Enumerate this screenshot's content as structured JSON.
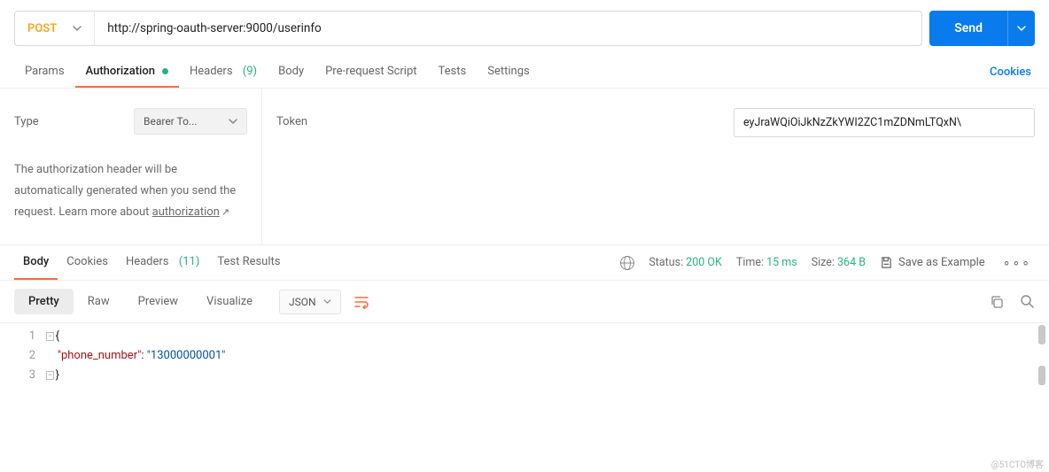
{
  "request": {
    "method": "POST",
    "url": "http://spring-oauth-server:9000/userinfo",
    "send_label": "Send"
  },
  "req_tabs": {
    "params": "Params",
    "authorization": "Authorization",
    "headers": "Headers",
    "headers_count": "(9)",
    "body": "Body",
    "prereq": "Pre-request Script",
    "tests": "Tests",
    "settings": "Settings",
    "cookies": "Cookies"
  },
  "auth": {
    "type_label": "Type",
    "type_value": "Bearer To...",
    "desc_line": "The authorization header will be automatically generated when you send the request. Learn more about ",
    "desc_link": "authorization",
    "token_label": "Token",
    "token_value": "eyJraWQiOiJkNzZkYWI2ZC1mZDNmLTQxN\\"
  },
  "resp_tabs": {
    "body": "Body",
    "cookies": "Cookies",
    "headers": "Headers",
    "headers_count": "(11)",
    "tests": "Test Results"
  },
  "resp_meta": {
    "status_label": "Status:",
    "status_value": "200 OK",
    "time_label": "Time:",
    "time_value": "15 ms",
    "size_label": "Size:",
    "size_value": "364 B",
    "save_example": "Save as Example"
  },
  "fmt": {
    "pretty": "Pretty",
    "raw": "Raw",
    "preview": "Preview",
    "visualize": "Visualize",
    "lang": "JSON"
  },
  "code": {
    "lines": [
      "1",
      "2",
      "3"
    ],
    "l1": "{",
    "l2_key": "\"phone_number\"",
    "l2_colon": ": ",
    "l2_val": "\"13000000001\"",
    "l3": "}"
  },
  "watermark": "@51CTO博客"
}
